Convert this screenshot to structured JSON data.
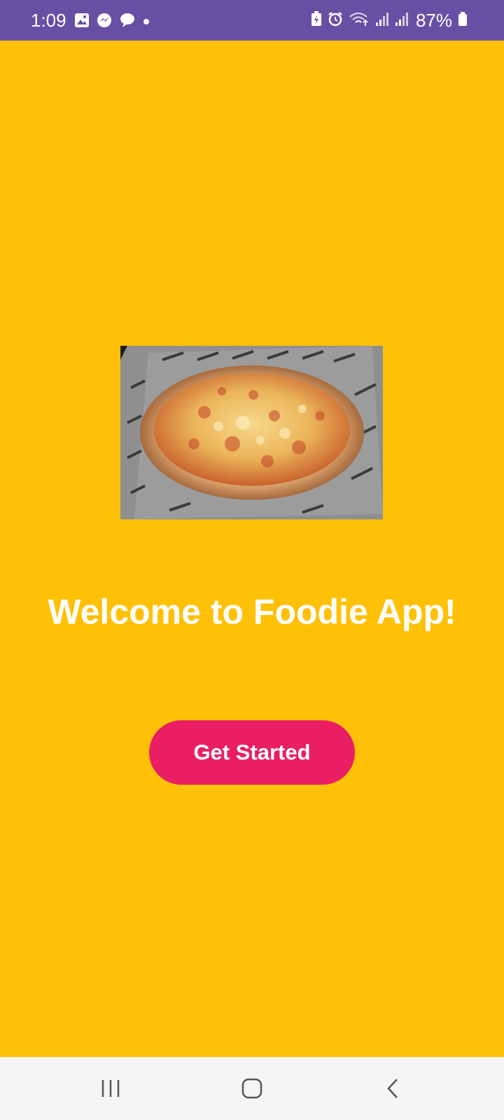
{
  "status_bar": {
    "time": "1:09",
    "battery_percent": "87%",
    "background_color": "#6750A4",
    "left_icons": [
      "gallery-icon",
      "messenger-icon",
      "chat-bubble-icon",
      "dot-icon"
    ],
    "right_icons": [
      "battery-saver-icon",
      "alarm-icon",
      "wifi-icon",
      "signal-icon",
      "signal-icon",
      "battery-icon"
    ]
  },
  "main": {
    "background_color": "#FFC107",
    "hero_image": {
      "icon": "pizza-image"
    },
    "title": "Welcome to Foodie App!",
    "get_started_label": "Get Started",
    "button_color": "#E91E63"
  },
  "nav_bar": {
    "items": [
      "recent-apps-icon",
      "home-icon",
      "back-icon"
    ]
  }
}
